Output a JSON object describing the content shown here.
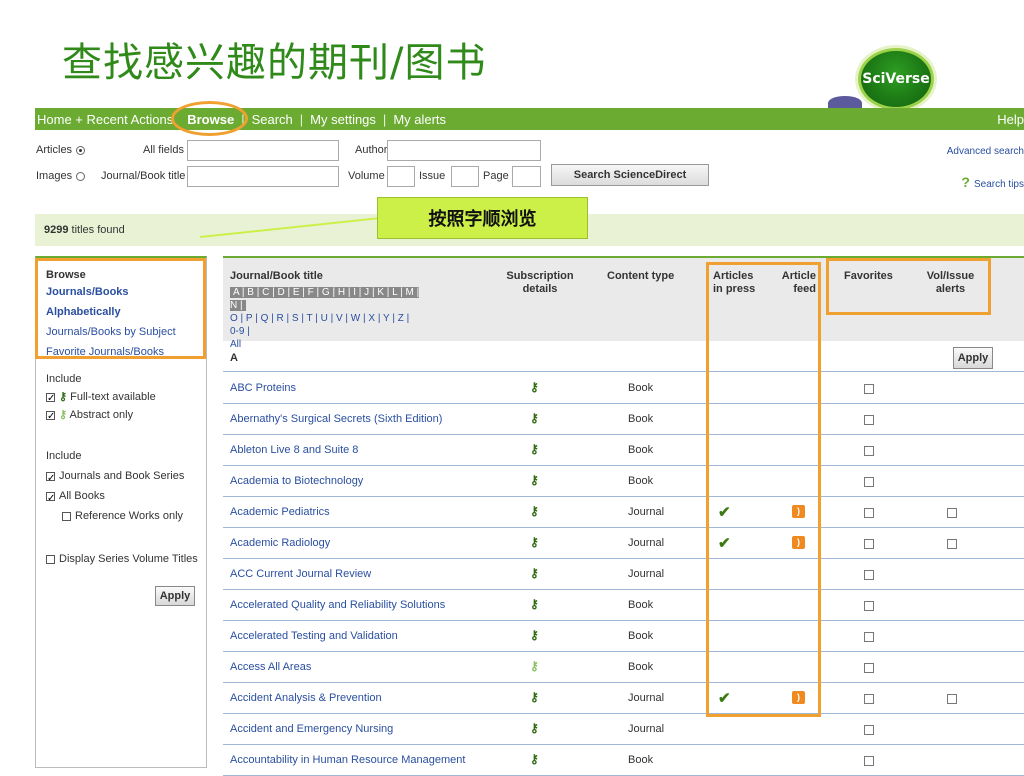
{
  "slide_title": "查找感兴趣的期刊/图书",
  "logo_text": "SciVerse",
  "nav": {
    "home": "Home + Recent Actions",
    "browse": "Browse",
    "search": "Search",
    "settings": "My settings",
    "alerts": "My alerts",
    "help": "Help"
  },
  "search": {
    "articles": "Articles",
    "images": "Images",
    "all_fields": "All fields",
    "journal_title": "Journal/Book title",
    "author": "Author",
    "volume": "Volume",
    "issue": "Issue",
    "page": "Page",
    "button": "Search ScienceDirect",
    "advanced": "Advanced search",
    "tips": "Search tips"
  },
  "found": {
    "count": "9299",
    "text": " titles found"
  },
  "callout": "按照字顺浏览",
  "sidebar": {
    "title": "Browse",
    "links": [
      "Journals/Books Alphabetically",
      "Journals/Books by Subject",
      "Favorite Journals/Books"
    ],
    "include1": "Include",
    "fulltext": "Full-text available",
    "abstract": "Abstract only",
    "include2": "Include",
    "journals": "Journals and Book Series",
    "allbooks": "All Books",
    "reference": "Reference Works only",
    "display": "Display Series Volume Titles",
    "apply": "Apply"
  },
  "table": {
    "h_title": "Journal/Book title",
    "alpha1": "A | B | C | D | E | F | G | H | I | J | K | L | M | N |",
    "alpha2": "O | P | Q | R | S | T | U | V | W | X | Y | Z | 0-9 |",
    "alpha3": "All",
    "h_sub1": "Subscription",
    "h_sub2": "details",
    "h_content": "Content type",
    "h_inpress1": "Articles",
    "h_inpress2": "in press",
    "h_feed1": "Article",
    "h_feed2": "feed",
    "h_fav": "Favorites",
    "h_vol1": "Vol/Issue",
    "h_vol2": "alerts",
    "letter": "A",
    "apply": "Apply",
    "rows": [
      {
        "title": "ABC Proteins",
        "type": "Book",
        "inpress": false,
        "feed": false,
        "vol": false,
        "light": false
      },
      {
        "title": "Abernathy's Surgical Secrets (Sixth Edition)",
        "type": "Book",
        "inpress": false,
        "feed": false,
        "vol": false,
        "light": false
      },
      {
        "title": "Ableton Live 8 and Suite 8",
        "type": "Book",
        "inpress": false,
        "feed": false,
        "vol": false,
        "light": false
      },
      {
        "title": "Academia to Biotechnology",
        "type": "Book",
        "inpress": false,
        "feed": false,
        "vol": false,
        "light": false
      },
      {
        "title": "Academic Pediatrics",
        "type": "Journal",
        "inpress": true,
        "feed": true,
        "vol": true,
        "light": false
      },
      {
        "title": "Academic Radiology",
        "type": "Journal",
        "inpress": true,
        "feed": true,
        "vol": true,
        "light": false
      },
      {
        "title": "ACC Current Journal Review",
        "type": "Journal",
        "inpress": false,
        "feed": false,
        "vol": false,
        "light": false
      },
      {
        "title": "Accelerated Quality and Reliability Solutions",
        "type": "Book",
        "inpress": false,
        "feed": false,
        "vol": false,
        "light": false
      },
      {
        "title": "Accelerated Testing and Validation",
        "type": "Book",
        "inpress": false,
        "feed": false,
        "vol": false,
        "light": false
      },
      {
        "title": "Access All Areas",
        "type": "Book",
        "inpress": false,
        "feed": false,
        "vol": false,
        "light": true
      },
      {
        "title": "Accident Analysis & Prevention",
        "type": "Journal",
        "inpress": true,
        "feed": true,
        "vol": true,
        "light": false
      },
      {
        "title": "Accident and Emergency Nursing",
        "type": "Journal",
        "inpress": false,
        "feed": false,
        "vol": false,
        "light": false
      },
      {
        "title": "Accountability in Human Resource Management",
        "type": "Book",
        "inpress": false,
        "feed": false,
        "vol": false,
        "light": false
      }
    ]
  },
  "icons": {
    "key": "key-icon",
    "check": "check-icon",
    "rss": "rss-icon",
    "help": "question-icon"
  },
  "colors": {
    "accent": "#6bab32",
    "highlight": "#f0a030",
    "callout": "#ccf048",
    "link": "#2a4fa0"
  }
}
